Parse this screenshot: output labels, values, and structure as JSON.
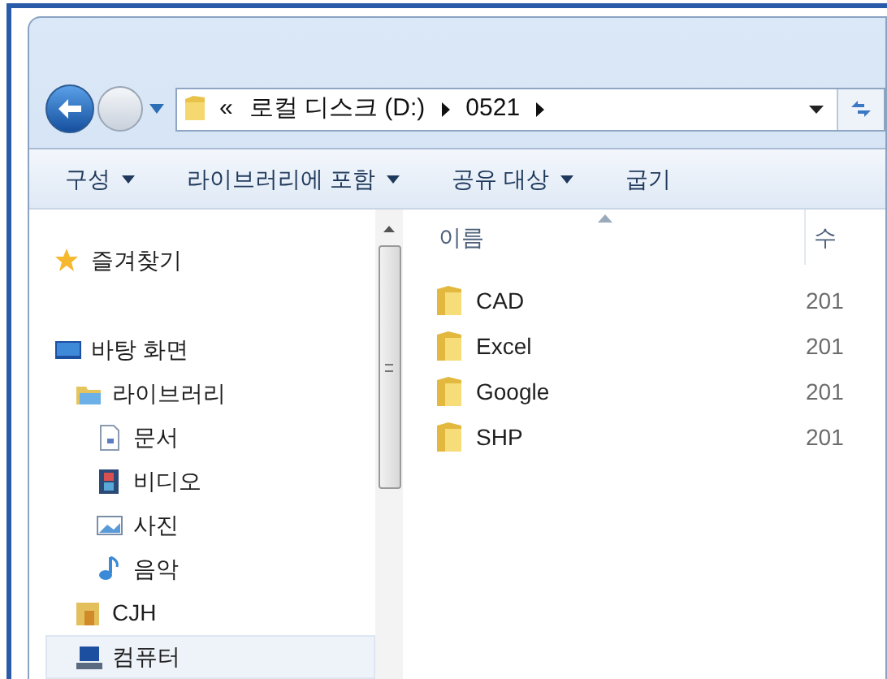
{
  "address_bar": {
    "overflow": "«",
    "segments": [
      "로컬 디스크 (D:)",
      "0521"
    ]
  },
  "toolbar": [
    {
      "label": "구성",
      "dropdown": true
    },
    {
      "label": "라이브러리에 포함",
      "dropdown": true
    },
    {
      "label": "공유 대상",
      "dropdown": true
    },
    {
      "label": "굽기",
      "dropdown": false
    }
  ],
  "navigation_pane": [
    {
      "kind": "star",
      "label": "즐겨찾기",
      "selected": false
    },
    {
      "kind": "desktop",
      "label": "바탕 화면",
      "selected": false,
      "children": [
        {
          "kind": "library",
          "label": "라이브러리",
          "selected": false,
          "children": [
            {
              "kind": "document",
              "label": "문서",
              "selected": false
            },
            {
              "kind": "video",
              "label": "비디오",
              "selected": false
            },
            {
              "kind": "photo",
              "label": "사진",
              "selected": false
            },
            {
              "kind": "music",
              "label": "음악",
              "selected": false
            }
          ]
        },
        {
          "kind": "user",
          "label": "CJH",
          "selected": false
        },
        {
          "kind": "computer",
          "label": "컴퓨터",
          "selected": true
        }
      ]
    }
  ],
  "file_list": {
    "columns": [
      "이름",
      "수"
    ],
    "rows": [
      {
        "name": "CAD",
        "date": "201"
      },
      {
        "name": "Excel",
        "date": "201"
      },
      {
        "name": "Google",
        "date": "201"
      },
      {
        "name": "SHP",
        "date": "201"
      }
    ]
  }
}
